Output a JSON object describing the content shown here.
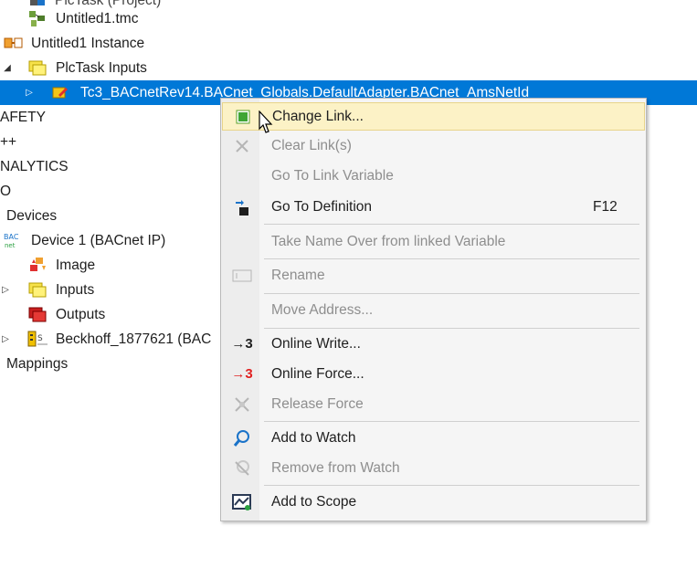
{
  "tree": {
    "rows": [
      {
        "label": "Untitled1.tmc"
      },
      {
        "label": "Untitled1 Instance"
      },
      {
        "label": "PlcTask Inputs"
      },
      {
        "label": "Tc3_BACnetRev14.BACnet_Globals.DefaultAdapter.BACnet_AmsNetId"
      },
      {
        "label": "AFETY"
      },
      {
        "label": "++"
      },
      {
        "label": "NALYTICS"
      },
      {
        "label": "O"
      },
      {
        "label": "Devices"
      },
      {
        "label": "Device 1 (BACnet IP)"
      },
      {
        "label": "Image"
      },
      {
        "label": "Inputs"
      },
      {
        "label": "Outputs"
      },
      {
        "label": "Beckhoff_1877621 (BAC"
      },
      {
        "label": "Mappings"
      }
    ],
    "partial_top_label": "PlcTask (Project)"
  },
  "context_menu": {
    "items": [
      {
        "label": "Change Link...",
        "icon": "change-link-icon"
      },
      {
        "label": "Clear Link(s)",
        "icon": "clear-link-icon"
      },
      {
        "label": "Go To Link Variable",
        "icon": ""
      },
      {
        "label": "Go To Definition",
        "shortcut": "F12",
        "icon": "go-to-definition-icon"
      },
      {
        "label": "Take Name Over from linked Variable",
        "icon": ""
      },
      {
        "label": "Rename",
        "icon": "rename-icon"
      },
      {
        "label": "Move Address...",
        "icon": ""
      },
      {
        "label": "Online Write...",
        "icon": "online-write-icon",
        "icon_text": "→3"
      },
      {
        "label": "Online Force...",
        "icon": "online-force-icon",
        "icon_text": "→3"
      },
      {
        "label": "Release Force",
        "icon": "release-force-icon"
      },
      {
        "label": "Add to Watch",
        "icon": "magnifier-icon"
      },
      {
        "label": "Remove from Watch",
        "icon": "remove-watch-icon"
      },
      {
        "label": "Add to Scope",
        "icon": "scope-icon"
      }
    ]
  },
  "colors": {
    "selection": "#0078d7",
    "menu_hover": "#fcf2c6",
    "disabled_text": "#8e8e8e"
  }
}
